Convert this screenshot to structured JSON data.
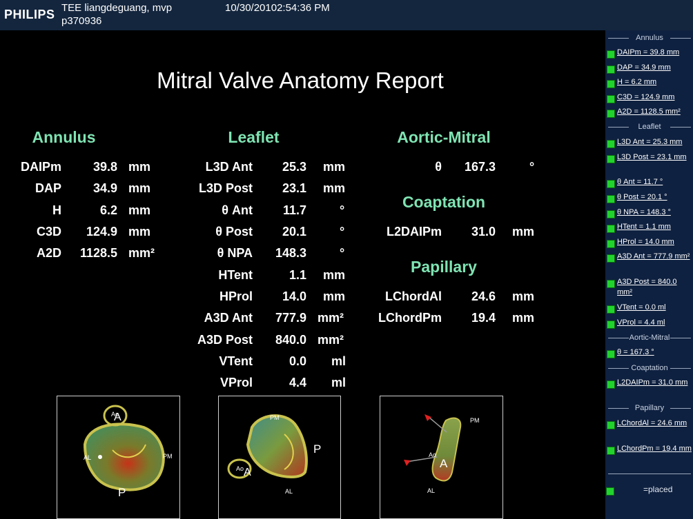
{
  "header": {
    "logo": "PHILIPS",
    "patient_name": "TEE liangdeguang, mvp",
    "patient_id": "p370936",
    "timestamp": "10/30/20102:54:36 PM"
  },
  "report": {
    "title": "Mitral Valve Anatomy Report",
    "sections": {
      "annulus": "Annulus",
      "leaflet": "Leaflet",
      "aortic_mitral": "Aortic-Mitral",
      "coaptation": "Coaptation",
      "papillary": "Papillary"
    },
    "annulus": [
      {
        "label": "DAIPm",
        "value": "39.8",
        "unit": "mm"
      },
      {
        "label": "DAP",
        "value": "34.9",
        "unit": "mm"
      },
      {
        "label": "H",
        "value": "6.2",
        "unit": "mm"
      },
      {
        "label": "C3D",
        "value": "124.9",
        "unit": "mm"
      },
      {
        "label": "A2D",
        "value": "1128.5",
        "unit": "mm²"
      }
    ],
    "leaflet": [
      {
        "label": "L3D Ant",
        "value": "25.3",
        "unit": "mm"
      },
      {
        "label": "L3D Post",
        "value": "23.1",
        "unit": "mm"
      },
      {
        "label": "θ Ant",
        "value": "11.7",
        "unit": "°"
      },
      {
        "label": "θ Post",
        "value": "20.1",
        "unit": "°"
      },
      {
        "label": "θ NPA",
        "value": "148.3",
        "unit": "°"
      },
      {
        "label": "HTent",
        "value": "1.1",
        "unit": "mm"
      },
      {
        "label": "HProl",
        "value": "14.0",
        "unit": "mm"
      },
      {
        "label": "A3D Ant",
        "value": "777.9",
        "unit": "mm²"
      },
      {
        "label": "A3D Post",
        "value": "840.0",
        "unit": "mm²"
      },
      {
        "label": "VTent",
        "value": "0.0",
        "unit": "ml"
      },
      {
        "label": "VProl",
        "value": "4.4",
        "unit": "ml"
      }
    ],
    "aortic_mitral": [
      {
        "label": "θ",
        "value": "167.3",
        "unit": "°"
      }
    ],
    "coaptation": [
      {
        "label": "L2DAIPm",
        "value": "31.0",
        "unit": "mm"
      }
    ],
    "papillary": [
      {
        "label": "LChordAl",
        "value": "24.6",
        "unit": "mm"
      },
      {
        "label": "LChordPm",
        "value": "19.4",
        "unit": "mm"
      }
    ]
  },
  "images": {
    "view1": {
      "ao": "Ao",
      "a": "A",
      "al": "AL",
      "pm": "PM",
      "p": "P"
    },
    "view2": {
      "ao": "Ao",
      "a": "A",
      "pm": "PM",
      "p": "P",
      "al": "AL"
    },
    "view3": {
      "ao": "Ao",
      "a": "A",
      "pm": "PM",
      "al": "AL"
    }
  },
  "sidebar": {
    "groups": {
      "annulus": "Annulus",
      "leaflet": "Leaflet",
      "aortic_mitral": "Aortic-Mitral",
      "coaptation": "Coaptation",
      "papillary": "Papillary"
    },
    "items": {
      "daipm": "DAIPm = 39.8 mm",
      "dap": "DAP = 34.9 mm",
      "h": "H = 6.2 mm",
      "c3d": "C3D = 124.9 mm",
      "a2d": "A2D = 1128.5 mm²",
      "l3d_ant": "L3D Ant = 25.3 mm",
      "l3d_post": "L3D Post = 23.1 mm",
      "theta_ant": "θ Ant = 11.7 °",
      "theta_post": "θ Post = 20.1 °",
      "theta_npa": "θ NPA = 148.3 °",
      "htent": "HTent = 1.1 mm",
      "hprol": "HProl = 14.0 mm",
      "a3d_ant": "A3D Ant = 777.9 mm²",
      "a3d_post": "A3D Post = 840.0 mm²",
      "vtent": "VTent = 0.0 ml",
      "vprol": "VProl = 4.4 ml",
      "theta": "θ = 167.3 °",
      "l2daipm": "L2DAIPm = 31.0 mm",
      "lchordal": "LChordAl = 24.6 mm",
      "lchordpm": "LChordPm = 19.4 mm"
    },
    "legend": "=placed"
  },
  "colors": {
    "section_header": "#7fe4b3",
    "checkbox": "#22d32e",
    "header_bg": "#14263e",
    "sidebar_bg": "#0f2140"
  }
}
